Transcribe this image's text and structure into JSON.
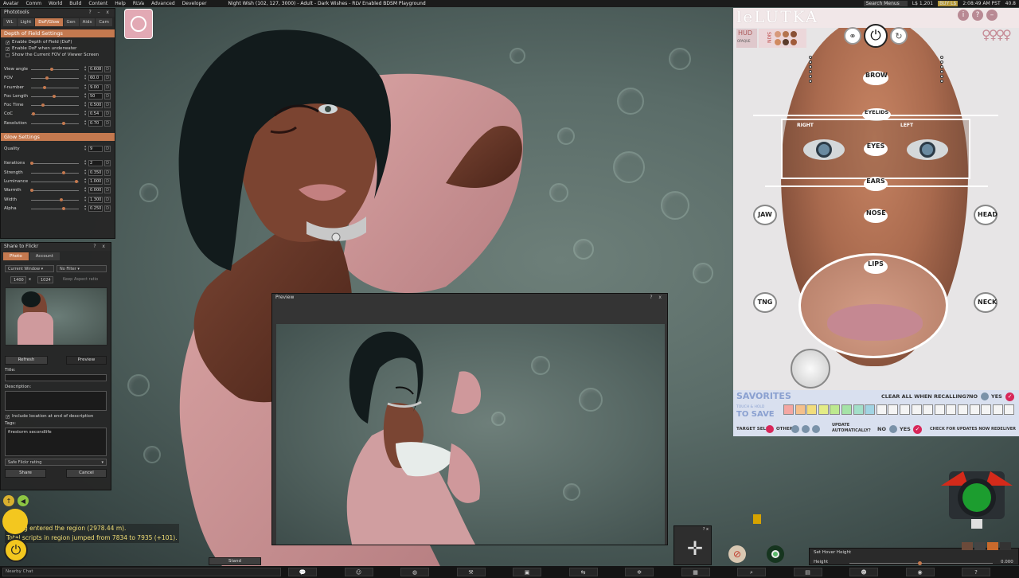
{
  "menubar": {
    "items": [
      "Avatar",
      "Comm",
      "World",
      "Build",
      "Content",
      "Help",
      "RLVa",
      "Advanced",
      "Developer"
    ],
    "title": "Night Wish (102, 127, 3000) - Adult - Dark Wishes - RLV Enabled BDSM Playground",
    "search_placeholder": "Search Menus",
    "balance": "L$ 1,201",
    "buy": "BUY L$",
    "time": "2:08:49 AM PST",
    "fps": "40.8"
  },
  "phototools": {
    "title": "Phototools",
    "tabs": [
      "WL",
      "Light",
      "DoF/Glow",
      "Gen",
      "Aids",
      "Cam"
    ],
    "active_tab": "DoF/Glow",
    "dof_header": "Depth of Field Settings",
    "checks": [
      {
        "label": "Enable Depth of Field (DoF)",
        "checked": true
      },
      {
        "label": "Enable DoF when underwater",
        "checked": true
      },
      {
        "label": "Show the Current FOV of Viewer Screen",
        "checked": false
      }
    ],
    "dof_rows": [
      {
        "label": "View angle",
        "value": "0.608",
        "level": 0.45
      },
      {
        "label": "FOV",
        "value": "60.0",
        "level": 0.35
      },
      {
        "label": "f-number",
        "value": "9.00",
        "level": 0.3
      },
      {
        "label": "Foc Length",
        "value": "50",
        "level": 0.5
      },
      {
        "label": "Foc Time",
        "value": "0.500",
        "level": 0.25
      },
      {
        "label": "CoC",
        "value": "0.54",
        "level": 0.05
      },
      {
        "label": "Resolution",
        "value": "0.70",
        "level": 0.7
      }
    ],
    "glow_header": "Glow Settings",
    "quality_label": "Quality",
    "quality_value": "9",
    "glow_rows": [
      {
        "label": "Iterations",
        "value": "2",
        "level": 0.02
      },
      {
        "label": "Strength",
        "value": "0.350",
        "level": 0.7
      },
      {
        "label": "Luminance",
        "value": "1.000",
        "level": 0.98
      },
      {
        "label": "Warmth",
        "value": "0.000",
        "level": 0.02
      },
      {
        "label": "Width",
        "value": "1.300",
        "level": 0.65
      },
      {
        "label": "Alpha",
        "value": "0.250",
        "level": 0.7
      }
    ]
  },
  "flickr": {
    "title": "Share to Flickr",
    "tabs": [
      "Photo",
      "Account"
    ],
    "source": "Current Window",
    "filter": "No Filter",
    "width": "1400",
    "x": "x",
    "height": "1024",
    "keep_aspect": "Keep Aspect ratio",
    "refresh": "Refresh",
    "preview": "Preview",
    "title_label": "Title:",
    "desc_label": "Description:",
    "include_location": "Include location at end of description",
    "tags_label": "Tags:",
    "tags_value": "firestorm secondlife",
    "rating": "Safe Flickr rating",
    "share": "Share",
    "cancel": "Cancel"
  },
  "preview": {
    "title": "Preview",
    "controls": "?  x"
  },
  "chat": {
    "lines": [
      "Li Ming entered the region (2978.44 m).",
      "Total scripts in region jumped from 7834 to 7935 (+101)."
    ],
    "nearby": "Nearby Chat",
    "stand": "Stand"
  },
  "hud": {
    "logo": "leLUTKA",
    "hud_label": "HUD",
    "opaque_label": "OPAQUE",
    "skin_label": "SKIN",
    "regions": {
      "brow": "BROW",
      "eyelids": "EYELIDS",
      "eyes": "EYES",
      "ears": "EARS",
      "nose": "NOSE",
      "lips": "LIPS",
      "jaw": "JAW",
      "head": "HEAD",
      "tng": "TNG",
      "neck": "NECK"
    },
    "right": "RIGHT",
    "left": "LEFT",
    "savorites": "SAVORITES",
    "clear_all": "CLEAR ALL WHEN RECALLING?",
    "no": "NO",
    "yes": "YES",
    "touch_hold": "TOUCH & HOLD",
    "to_save": "TO SAVE",
    "target_self": "TARGET SELF",
    "other": "OTHER",
    "update": "UPDATE",
    "automatically": "AUTOMATICALLY?",
    "check_updates": "CHECK FOR UPDATES NOW",
    "redeliver": "REDELIVER",
    "fav_colors": [
      "#f4a7a3",
      "#f4c08c",
      "#f2dd7c",
      "#e3ec86",
      "#bde98f",
      "#a5e3a7",
      "#a3dfc9",
      "#a2d4e3"
    ],
    "accent": "#d82659"
  },
  "hover": {
    "title": "Set Hover Height",
    "label": "Height",
    "value": "0.000"
  },
  "bottombar": {
    "icons": [
      "chat-bubble-icon",
      "people-icon",
      "world-icon",
      "build-icon",
      "snapshot-icon",
      "movement-icon",
      "settings-icon",
      "map-icon",
      "search-icon",
      "inventory-icon",
      "profile-icon",
      "camera-icon",
      "help-icon"
    ]
  }
}
